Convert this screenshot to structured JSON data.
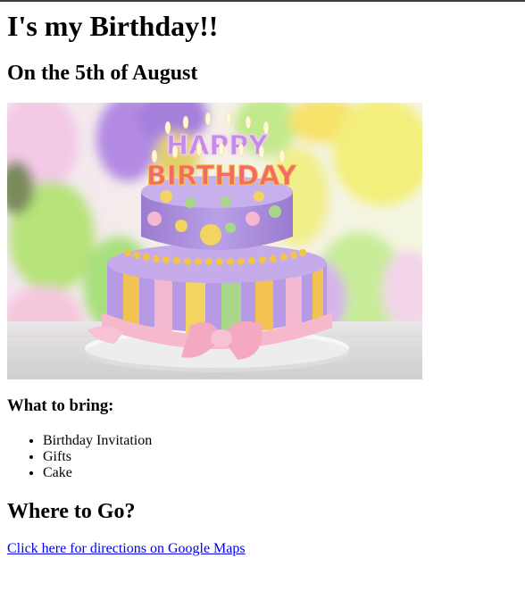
{
  "heading": "I's my Birthday!!",
  "date": "On the 5th of August",
  "image": {
    "cake_text_top": "HAPPY",
    "cake_text_bottom": "BIRTHDAY",
    "colors": {
      "bg_balloon_purple": "#b48be0",
      "bg_balloon_yellow": "#f4f07a",
      "bg_balloon_green": "#c8ec8a",
      "cake_top": "#a98ad8",
      "cake_bottom_stripe_purple": "#b79ae6",
      "cake_bottom_stripe_yellow": "#f3d45c",
      "cake_bottom_stripe_pink": "#f5b8d2",
      "ribbon_pink": "#f6b9cc"
    }
  },
  "bring": {
    "title": "What to bring:",
    "items": [
      "Birthday Invitation",
      "Gifts",
      "Cake"
    ]
  },
  "where": {
    "title": "Where to Go?",
    "link_text": "Click here for directions on Google Maps"
  }
}
